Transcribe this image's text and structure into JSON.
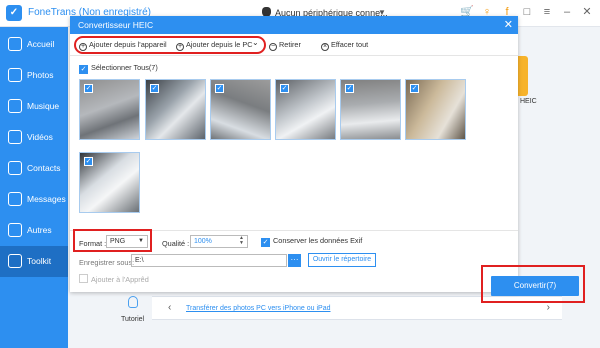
{
  "app": {
    "title": "FoneTrans (Non enregistré)",
    "device": "Aucun périphérique conne..."
  },
  "sidebar": {
    "items": [
      {
        "label": "Accueil",
        "icon": "home-icon"
      },
      {
        "label": "Photos",
        "icon": "photo-icon"
      },
      {
        "label": "Musique",
        "icon": "music-icon"
      },
      {
        "label": "Vidéos",
        "icon": "video-icon"
      },
      {
        "label": "Contacts",
        "icon": "contact-icon"
      },
      {
        "label": "Messages",
        "icon": "message-icon"
      },
      {
        "label": "Autres",
        "icon": "more-icon"
      },
      {
        "label": "Toolkit",
        "icon": "toolkit-icon"
      }
    ],
    "active": "Toolkit",
    "color": "#2d8ff0"
  },
  "background": {
    "heic_label": "HEIC",
    "tutorial_label": "Tutoriel",
    "tutorial_link": "Transférer des photos PC vers iPhone ou iPad"
  },
  "dialog": {
    "title": "Convertisseur HEIC",
    "toolbar": {
      "add_device": "Ajouter depuis l'appareil",
      "add_pc": "Ajouter depuis le PC",
      "remove": "Retirer",
      "clear": "Effacer tout"
    },
    "select_all": "Sélectionner Tous(7)",
    "thumbnails": [
      {
        "checked": true
      },
      {
        "checked": true
      },
      {
        "checked": true
      },
      {
        "checked": true
      },
      {
        "checked": true
      },
      {
        "checked": true
      },
      {
        "checked": true
      }
    ],
    "format_label": "Format :",
    "format_value": "PNG",
    "quality_label": "Qualité :",
    "quality_value": "100%",
    "keep_exif": "Conserver les données Exif",
    "save_label": "Enregistrer sous:",
    "save_path": "E:\\",
    "browse_label": "···",
    "open_dir": "Ouvrir le répertoire",
    "add_itunes": "Ajouter à l'Apprêd",
    "convert_label": "Convertir(7)",
    "accent": "#2d8ff0",
    "highlight": "#e02020"
  }
}
